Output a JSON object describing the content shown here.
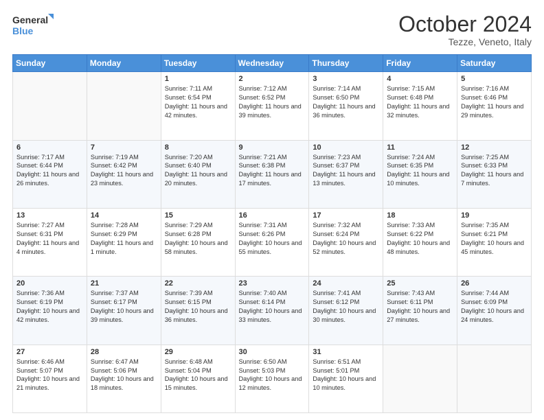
{
  "header": {
    "logo_line1": "General",
    "logo_line2": "Blue",
    "month": "October 2024",
    "location": "Tezze, Veneto, Italy"
  },
  "weekdays": [
    "Sunday",
    "Monday",
    "Tuesday",
    "Wednesday",
    "Thursday",
    "Friday",
    "Saturday"
  ],
  "weeks": [
    [
      {
        "day": "",
        "info": ""
      },
      {
        "day": "",
        "info": ""
      },
      {
        "day": "1",
        "info": "Sunrise: 7:11 AM\nSunset: 6:54 PM\nDaylight: 11 hours and 42 minutes."
      },
      {
        "day": "2",
        "info": "Sunrise: 7:12 AM\nSunset: 6:52 PM\nDaylight: 11 hours and 39 minutes."
      },
      {
        "day": "3",
        "info": "Sunrise: 7:14 AM\nSunset: 6:50 PM\nDaylight: 11 hours and 36 minutes."
      },
      {
        "day": "4",
        "info": "Sunrise: 7:15 AM\nSunset: 6:48 PM\nDaylight: 11 hours and 32 minutes."
      },
      {
        "day": "5",
        "info": "Sunrise: 7:16 AM\nSunset: 6:46 PM\nDaylight: 11 hours and 29 minutes."
      }
    ],
    [
      {
        "day": "6",
        "info": "Sunrise: 7:17 AM\nSunset: 6:44 PM\nDaylight: 11 hours and 26 minutes."
      },
      {
        "day": "7",
        "info": "Sunrise: 7:19 AM\nSunset: 6:42 PM\nDaylight: 11 hours and 23 minutes."
      },
      {
        "day": "8",
        "info": "Sunrise: 7:20 AM\nSunset: 6:40 PM\nDaylight: 11 hours and 20 minutes."
      },
      {
        "day": "9",
        "info": "Sunrise: 7:21 AM\nSunset: 6:38 PM\nDaylight: 11 hours and 17 minutes."
      },
      {
        "day": "10",
        "info": "Sunrise: 7:23 AM\nSunset: 6:37 PM\nDaylight: 11 hours and 13 minutes."
      },
      {
        "day": "11",
        "info": "Sunrise: 7:24 AM\nSunset: 6:35 PM\nDaylight: 11 hours and 10 minutes."
      },
      {
        "day": "12",
        "info": "Sunrise: 7:25 AM\nSunset: 6:33 PM\nDaylight: 11 hours and 7 minutes."
      }
    ],
    [
      {
        "day": "13",
        "info": "Sunrise: 7:27 AM\nSunset: 6:31 PM\nDaylight: 11 hours and 4 minutes."
      },
      {
        "day": "14",
        "info": "Sunrise: 7:28 AM\nSunset: 6:29 PM\nDaylight: 11 hours and 1 minute."
      },
      {
        "day": "15",
        "info": "Sunrise: 7:29 AM\nSunset: 6:28 PM\nDaylight: 10 hours and 58 minutes."
      },
      {
        "day": "16",
        "info": "Sunrise: 7:31 AM\nSunset: 6:26 PM\nDaylight: 10 hours and 55 minutes."
      },
      {
        "day": "17",
        "info": "Sunrise: 7:32 AM\nSunset: 6:24 PM\nDaylight: 10 hours and 52 minutes."
      },
      {
        "day": "18",
        "info": "Sunrise: 7:33 AM\nSunset: 6:22 PM\nDaylight: 10 hours and 48 minutes."
      },
      {
        "day": "19",
        "info": "Sunrise: 7:35 AM\nSunset: 6:21 PM\nDaylight: 10 hours and 45 minutes."
      }
    ],
    [
      {
        "day": "20",
        "info": "Sunrise: 7:36 AM\nSunset: 6:19 PM\nDaylight: 10 hours and 42 minutes."
      },
      {
        "day": "21",
        "info": "Sunrise: 7:37 AM\nSunset: 6:17 PM\nDaylight: 10 hours and 39 minutes."
      },
      {
        "day": "22",
        "info": "Sunrise: 7:39 AM\nSunset: 6:15 PM\nDaylight: 10 hours and 36 minutes."
      },
      {
        "day": "23",
        "info": "Sunrise: 7:40 AM\nSunset: 6:14 PM\nDaylight: 10 hours and 33 minutes."
      },
      {
        "day": "24",
        "info": "Sunrise: 7:41 AM\nSunset: 6:12 PM\nDaylight: 10 hours and 30 minutes."
      },
      {
        "day": "25",
        "info": "Sunrise: 7:43 AM\nSunset: 6:11 PM\nDaylight: 10 hours and 27 minutes."
      },
      {
        "day": "26",
        "info": "Sunrise: 7:44 AM\nSunset: 6:09 PM\nDaylight: 10 hours and 24 minutes."
      }
    ],
    [
      {
        "day": "27",
        "info": "Sunrise: 6:46 AM\nSunset: 5:07 PM\nDaylight: 10 hours and 21 minutes."
      },
      {
        "day": "28",
        "info": "Sunrise: 6:47 AM\nSunset: 5:06 PM\nDaylight: 10 hours and 18 minutes."
      },
      {
        "day": "29",
        "info": "Sunrise: 6:48 AM\nSunset: 5:04 PM\nDaylight: 10 hours and 15 minutes."
      },
      {
        "day": "30",
        "info": "Sunrise: 6:50 AM\nSunset: 5:03 PM\nDaylight: 10 hours and 12 minutes."
      },
      {
        "day": "31",
        "info": "Sunrise: 6:51 AM\nSunset: 5:01 PM\nDaylight: 10 hours and 10 minutes."
      },
      {
        "day": "",
        "info": ""
      },
      {
        "day": "",
        "info": ""
      }
    ]
  ]
}
